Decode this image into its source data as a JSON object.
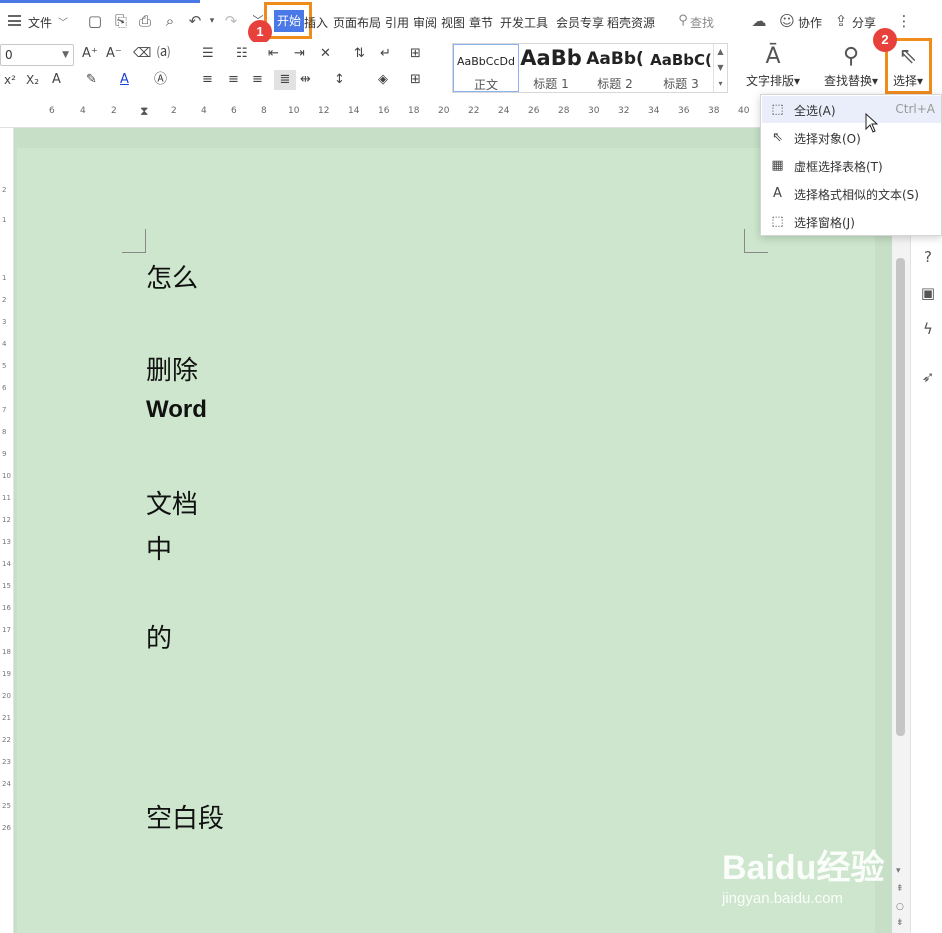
{
  "menubar": {
    "file_label": "文件",
    "tabs": [
      "开始",
      "插入",
      "页面布局",
      "引用",
      "审阅",
      "视图",
      "章节",
      "开发工具",
      "会员专享",
      "稻壳资源"
    ],
    "search_label": "查找",
    "collab_label": "协作",
    "share_label": "分享"
  },
  "badges": {
    "one": "1",
    "two": "2"
  },
  "ribbon": {
    "font_size_value": "0",
    "styles": [
      {
        "preview": "AaBbCcDd",
        "name": "正文"
      },
      {
        "preview": "AaBb",
        "name": "标题 1"
      },
      {
        "preview": "AaBb(",
        "name": "标题 2"
      },
      {
        "preview": "AaBbC(",
        "name": "标题 3"
      }
    ],
    "text_layout_label": "文字排版",
    "find_replace_label": "查找替换",
    "select_label": "选择"
  },
  "ruler": {
    "h_numbers": [
      "6",
      "4",
      "2",
      "2",
      "4",
      "6",
      "8",
      "10",
      "12",
      "14",
      "16",
      "18",
      "20",
      "22",
      "24",
      "26",
      "28",
      "30",
      "32",
      "34",
      "36",
      "38",
      "40"
    ],
    "v_numbers": [
      "2",
      "1",
      "1",
      "2",
      "3",
      "4",
      "5",
      "6",
      "7",
      "8",
      "9",
      "10",
      "11",
      "12",
      "13",
      "14",
      "15",
      "16",
      "17",
      "18",
      "19",
      "20",
      "21",
      "22",
      "23",
      "24",
      "25",
      "26"
    ]
  },
  "document": {
    "paragraphs": [
      "怎么",
      "删除",
      "Word",
      "文档",
      "中",
      "的",
      "空白段"
    ]
  },
  "select_menu": {
    "items": [
      {
        "icon": "select-all-icon",
        "label": "全选(A)",
        "shortcut": "Ctrl+A"
      },
      {
        "icon": "select-object-icon",
        "label": "选择对象(O)",
        "shortcut": ""
      },
      {
        "icon": "select-table-icon",
        "label": "虚框选择表格(T)",
        "shortcut": ""
      },
      {
        "icon": "select-similar-text-icon",
        "label": "选择格式相似的文本(S)",
        "shortcut": ""
      },
      {
        "icon": "selection-pane-icon",
        "label": "选择窗格(J)",
        "shortcut": ""
      }
    ]
  },
  "watermark": {
    "logo": "Baidu经验",
    "url": "jingyan.baidu.com"
  },
  "colors": {
    "accent": "#4a78e6",
    "highlight": "#f08c1c",
    "badge": "#e8413b",
    "page": "#cde6cd"
  }
}
